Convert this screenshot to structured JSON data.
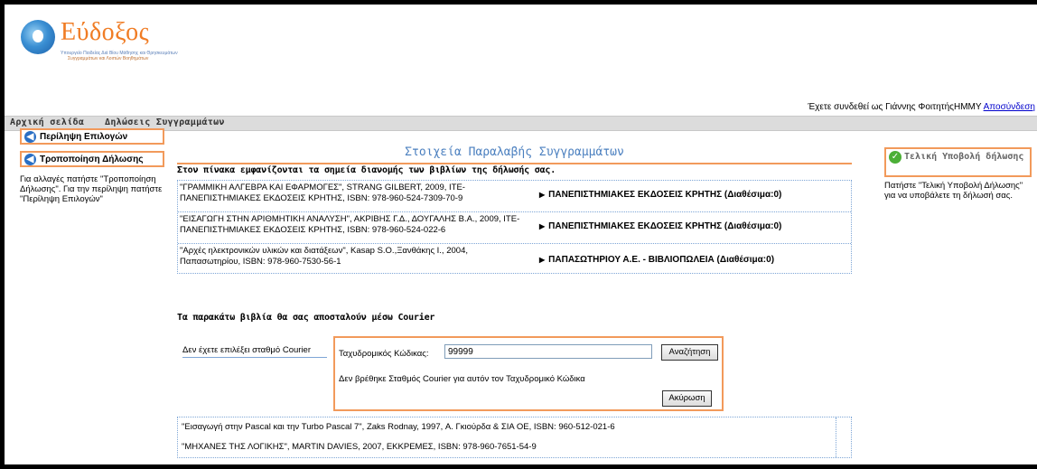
{
  "header": {
    "logo_text": "Εύδοξος",
    "logo_sub1": "Υπουργείο Παιδείας Διά Βίου Μάθησης και Θρησκευμάτων",
    "logo_sub2": "Συγγραμμάτων και Λοιπών Βοηθημάτων",
    "login_text": "Έχετε συνδεθεί ως Γιάννης ΦοιτητήςΗΜΜΥ",
    "logout_link": "Αποσύνδεση"
  },
  "menu": {
    "home": "Αρχική σελίδα",
    "declarations": "Δηλώσεις Συγγραμμάτων"
  },
  "left": {
    "btn_summary": "Περίληψη Επιλογών",
    "btn_modify": "Τροποποίηση Δήλωσης",
    "help_text": "Για αλλαγές πατήστε \"Τροποποίηση Δήλωσης\". Για την περίληψη πατήστε \"Περίληψη Επιλογών\""
  },
  "main": {
    "title": "Στοιχεία Παραλαβής Συγγραμμάτων",
    "table_heading": "Στον πίνακα εμφανίζονται τα σημεία διανομής των βιβλίων της δήλωσής σας.",
    "rows": [
      {
        "book": "\"ΓΡΑΜΜΙΚΗ ΑΛΓΕΒΡΑ ΚΑΙ ΕΦΑΡΜΟΓΕΣ\", STRANG GILBERT, 2009, ΙΤΕ-ΠΑΝΕΠΙΣΤΗΜΙΑΚΕΣ ΕΚΔΟΣΕΙΣ ΚΡΗΤΗΣ, ISBN: 978-960-524-7309-70-9",
        "distribution": "ΠΑΝΕΠΙΣΤΗΜΙΑΚΕΣ ΕΚΔΟΣΕΙΣ ΚΡΗΤΗΣ (Διαθέσιμα:0)"
      },
      {
        "book": "\"ΕΙΣΑΓΩΓΗ ΣΤΗΝ ΑΡΙΘΜΗΤΙΚΗ ΑΝΑΛΥΣΗ\", ΑΚΡΙΒΗΣ Γ.Δ., ΔΟΥΓΑΛΗΣ Β.Α., 2009, ΙΤΕ-ΠΑΝΕΠΙΣΤΗΜΙΑΚΕΣ ΕΚΔΟΣΕΙΣ ΚΡΗΤΗΣ, ISBN: 978-960-524-022-6",
        "distribution": "ΠΑΝΕΠΙΣΤΗΜΙΑΚΕΣ ΕΚΔΟΣΕΙΣ ΚΡΗΤΗΣ (Διαθέσιμα:0)"
      },
      {
        "book": "\"Αρχές ηλεκτρονικών υλικών και διατάξεων\", Kasap S.O.,Ξανθάκης Ι., 2004, Παπασωτηρίου, ISBN: 978-960-7530-56-1",
        "distribution": "ΠΑΠΑΣΩΤΗΡΙΟΥ Α.Ε. - ΒΙΒΛΙΟΠΩΛΕΙΑ (Διαθέσιμα:0)"
      }
    ],
    "courier_heading": "Τα παρακάτω βιβλία θα σας αποσταλούν μέσω Courier",
    "courier_label": "Δεν έχετε επιλέξει σταθμό Courier",
    "postal_label": "Ταχυδρομικός Κώδικας:",
    "postal_value": "99999",
    "search_button": "Αναζήτηση",
    "not_found_msg": "Δεν βρέθηκε Σταθμός Courier για αυτόν τον Ταχυδρομικό Κώδικα",
    "cancel_button": "Ακύρωση",
    "courier_books": [
      "\"Εισαγωγή στην Pascal και την Turbo Pascal 7\", Zaks Rodnay, 1997, Α. Γκιούρδα & ΣΙΑ ΟΕ, ISBN: 960-512-021-6",
      "\"ΜΗΧΑΝΕΣ ΤΗΣ ΛΟΓΙΚΗΣ\", MARTIN DAVIES, 2007, ΕΚΚΡΕΜΕΣ, ISBN: 978-960-7651-54-9"
    ]
  },
  "right": {
    "submit_btn": "Τελική Υποβολή δήλωσης",
    "help_text": "Πατήστε \"Τελική Υποβολή Δήλωσης\" για να υποβάλετε τη δήλωσή σας."
  },
  "colors": {
    "accent_orange": "#f29a5b",
    "title_blue": "#4a7fbf",
    "link_blue": "#0000cc"
  }
}
